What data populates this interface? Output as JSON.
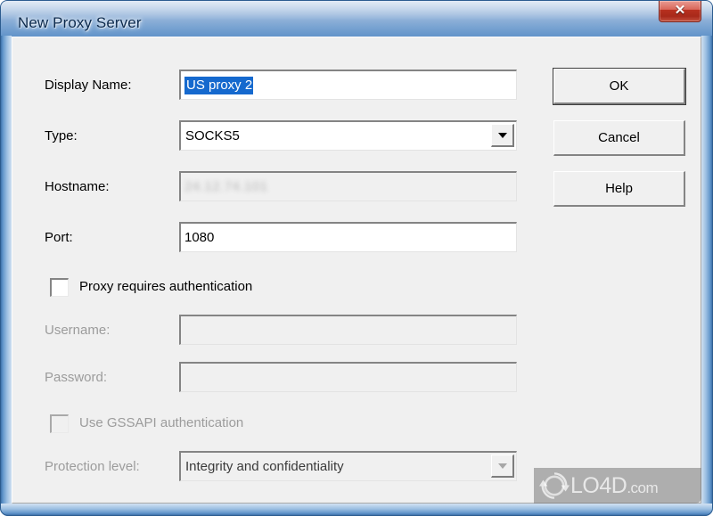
{
  "window": {
    "title": "New Proxy Server",
    "close_icon": "close-icon",
    "close_glyph": "✕",
    "accent_title_blue": "#4a82bf",
    "close_red": "#b8301f",
    "client_bg": "#f0f0f0",
    "selection_blue": "#1569ce"
  },
  "form": {
    "display_name": {
      "label": "Display Name:",
      "value": "US proxy 2",
      "placeholder": "",
      "selected": true,
      "enabled": true
    },
    "type": {
      "label": "Type:",
      "value": "SOCKS5",
      "options": [
        "SOCKS5"
      ],
      "enabled": true,
      "arrow_icon": "chevron-down-icon"
    },
    "hostname": {
      "label": "Hostname:",
      "value": "24.12.74.101",
      "placeholder": "",
      "enabled": false,
      "censored": true
    },
    "port": {
      "label": "Port:",
      "value": "1080",
      "placeholder": "",
      "enabled": true
    },
    "requires_auth": {
      "label": "Proxy requires authentication",
      "checked": false,
      "enabled": true
    },
    "username": {
      "label": "Username:",
      "value": "",
      "placeholder": "",
      "enabled": false
    },
    "password": {
      "label": "Password:",
      "value": "",
      "placeholder": "",
      "enabled": false
    },
    "gssapi": {
      "label": "Use GSSAPI authentication",
      "checked": false,
      "enabled": false
    },
    "protection_level": {
      "label": "Protection level:",
      "value": "Integrity and confidentiality",
      "options": [
        "Integrity and confidentiality"
      ],
      "enabled": false,
      "arrow_icon": "chevron-down-icon"
    }
  },
  "buttons": {
    "ok": "OK",
    "cancel": "Cancel",
    "help": "Help"
  },
  "watermark": {
    "name": "LO4D",
    "domain": ".com",
    "logo_icon": "circular-arrows-icon"
  }
}
